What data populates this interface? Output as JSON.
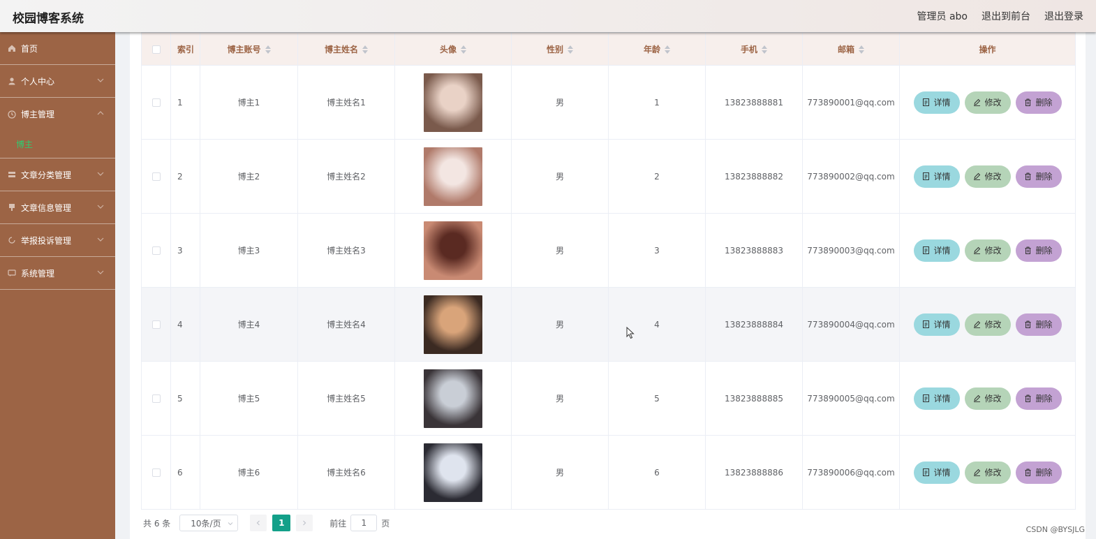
{
  "header": {
    "brand": "校园博客系统",
    "admin": "管理员 abo",
    "to_front": "退出到前台",
    "logout": "退出登录"
  },
  "sidebar": {
    "items": [
      {
        "label": "首页",
        "icon": "home-icon"
      },
      {
        "label": "个人中心",
        "icon": "user-icon"
      },
      {
        "label": "博主管理",
        "icon": "clock-icon",
        "expanded": true,
        "children": [
          "博主"
        ]
      },
      {
        "label": "文章分类管理",
        "icon": "category-icon"
      },
      {
        "label": "文章信息管理",
        "icon": "document-icon"
      },
      {
        "label": "举报投诉管理",
        "icon": "refresh-icon"
      },
      {
        "label": "系统管理",
        "icon": "message-icon"
      }
    ]
  },
  "table": {
    "headers": [
      "索引",
      "博主账号",
      "博主姓名",
      "头像",
      "性别",
      "年龄",
      "手机",
      "邮箱",
      "操作"
    ],
    "rows": [
      {
        "index": "1",
        "account": "博主1",
        "name": "博主姓名1",
        "gender": "男",
        "age": "1",
        "phone": "13823888881",
        "email": "773890001@qq.com"
      },
      {
        "index": "2",
        "account": "博主2",
        "name": "博主姓名2",
        "gender": "男",
        "age": "2",
        "phone": "13823888882",
        "email": "773890002@qq.com"
      },
      {
        "index": "3",
        "account": "博主3",
        "name": "博主姓名3",
        "gender": "男",
        "age": "3",
        "phone": "13823888883",
        "email": "773890003@qq.com"
      },
      {
        "index": "4",
        "account": "博主4",
        "name": "博主姓名4",
        "gender": "男",
        "age": "4",
        "phone": "13823888884",
        "email": "773890004@qq.com"
      },
      {
        "index": "5",
        "account": "博主5",
        "name": "博主姓名5",
        "gender": "男",
        "age": "5",
        "phone": "13823888885",
        "email": "773890005@qq.com"
      },
      {
        "index": "6",
        "account": "博主6",
        "name": "博主姓名6",
        "gender": "男",
        "age": "6",
        "phone": "13823888886",
        "email": "773890006@qq.com"
      }
    ],
    "actions": {
      "detail": "详情",
      "edit": "修改",
      "delete": "删除"
    }
  },
  "pagination": {
    "total": "共 6 条",
    "page_size": "10条/页",
    "current": "1",
    "goto_label": "前往",
    "goto_value": "1",
    "page_suffix": "页"
  },
  "watermark": "CSDN @BYSJLG",
  "colors": {
    "sidebar": "#9c6445",
    "active_submenu": "#2ecc71",
    "header_text": "#9c6445",
    "btn_detail": "#9ad8df",
    "btn_edit": "#b5d4b8",
    "btn_delete": "#c3a2d3",
    "page_active": "#13a089"
  }
}
